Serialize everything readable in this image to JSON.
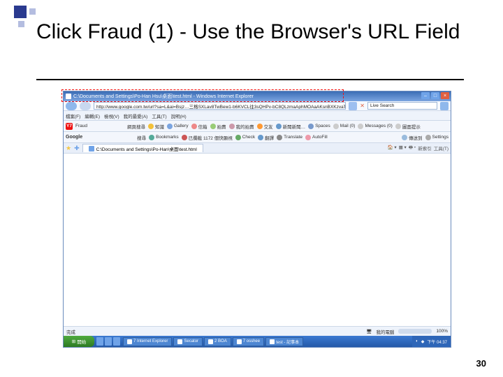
{
  "slide": {
    "title": "Click Fraud (1) - Use the Browser's URL Field",
    "page_number": "30"
  },
  "browser": {
    "window_title": "C:\\Documents and Settings\\Po-Han Hsu\\桌面\\test.html - Windows Internet Explorer",
    "address_bar": "http://www.google.com.tw/url?sa=L&ai=Bsjz…三格SXLav8TwBew1-b6KVCL往3sQHPv-bC8QLzmaAphMOAaAKsnBXKzvaT4gH01…",
    "search_box_placeholder": "Live Search",
    "menu": {
      "file": "檔案(F)",
      "edit": "編輯(E)",
      "view": "檢視(V)",
      "favorites": "我的最愛(A)",
      "tools": "工具(T)",
      "help": "說明(H)"
    },
    "yahoo_toolbar": {
      "brand": "Y7",
      "search_value": "Fraud",
      "search_button": "網頁搜尋",
      "items": [
        "知識",
        "Gallery",
        "信箱",
        "拍賣",
        "我的拍賣",
        "交友",
        "新聞新聞…",
        "Spaces",
        "Mail (0)",
        "Messages (0)",
        "圖面提示"
      ]
    },
    "google_toolbar": {
      "brand": "Google",
      "search_button": "搜尋",
      "items": [
        "Bookmarks",
        "已攔截 1172 個快顯視",
        "Check",
        "翻譯",
        "Translate",
        "AutoFill",
        "傳送到",
        "Settings"
      ]
    },
    "tab_label": "C:\\Documents and Settings\\Po-Han\\桌面\\test.html",
    "tab_right": [
      "新索引",
      "工具(T)"
    ],
    "status": {
      "left": "完成",
      "mid": "我的電腦",
      "zoom": "100%"
    },
    "taskbar": {
      "start": "開始",
      "apps": [
        "7 Internet Explorer",
        "Secator",
        "2 BOA",
        "7 osshee",
        "test - 記事本"
      ],
      "clock": "下午 04:37"
    }
  }
}
